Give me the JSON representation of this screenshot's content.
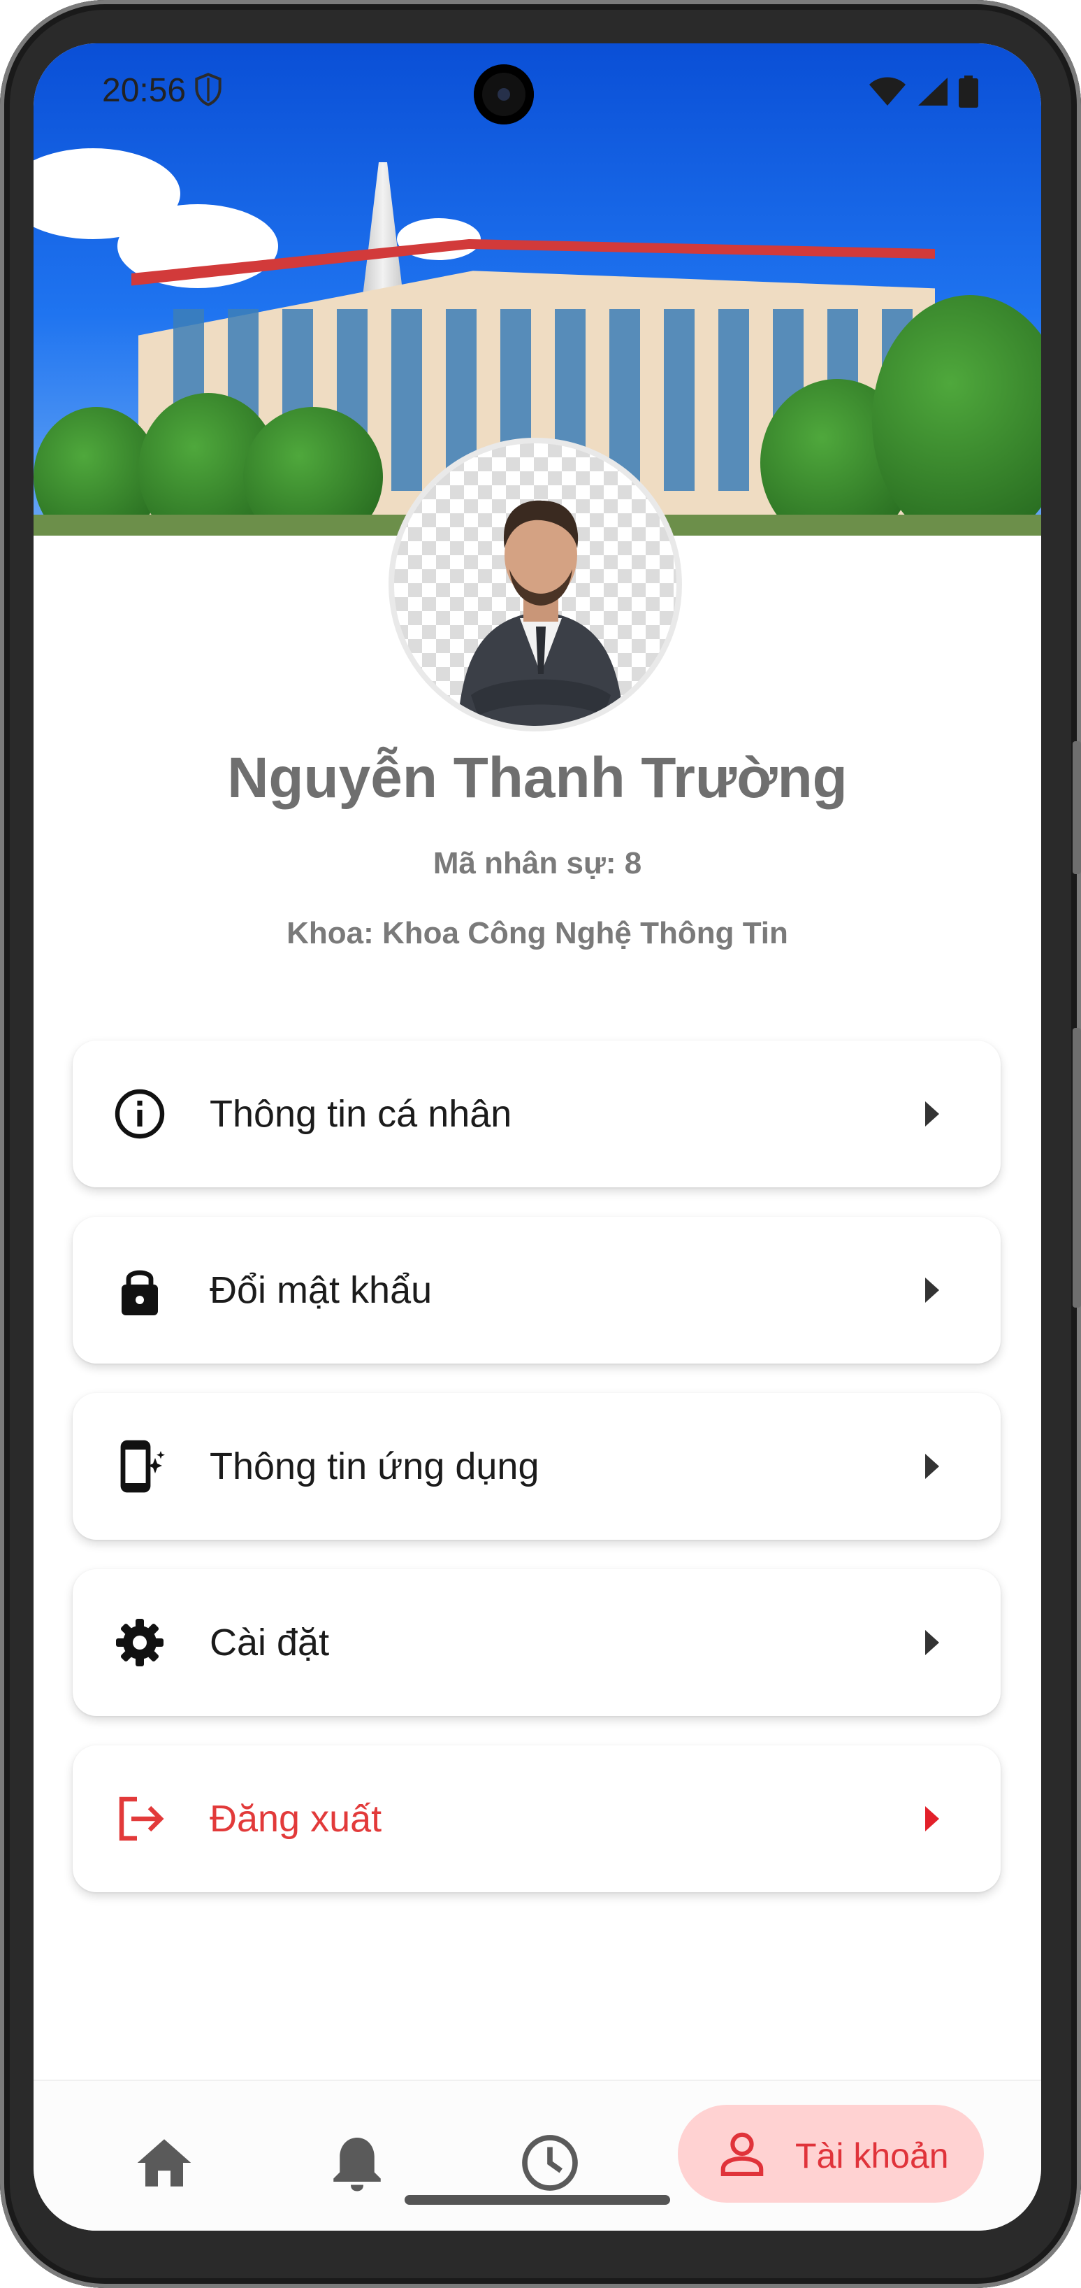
{
  "status_bar": {
    "time": "20:56"
  },
  "profile": {
    "name": "Nguyễn Thanh Trường",
    "employee_id": "Mã nhân sự: 8",
    "department": "Khoa: Khoa Công Nghệ Thông Tin"
  },
  "menu": [
    {
      "label": "Thông tin cá nhân",
      "icon": "info-icon"
    },
    {
      "label": "Đổi mật khẩu",
      "icon": "lock-icon"
    },
    {
      "label": "Thông tin ứng dụng",
      "icon": "app-info-icon"
    },
    {
      "label": "Cài đặt",
      "icon": "gear-icon"
    },
    {
      "label": "Đăng xuất",
      "icon": "logout-icon"
    }
  ],
  "bottom_nav": {
    "items": [
      {
        "icon": "home-icon"
      },
      {
        "icon": "bell-icon"
      },
      {
        "icon": "clock-icon"
      },
      {
        "icon": "person-icon",
        "label": "Tài khoản",
        "active": true
      }
    ]
  },
  "colors": {
    "accent": "#e0333a",
    "accent_bg": "#ffd2d2",
    "name_text": "#6f6f6f",
    "menu_text": "#1b1b1b"
  }
}
